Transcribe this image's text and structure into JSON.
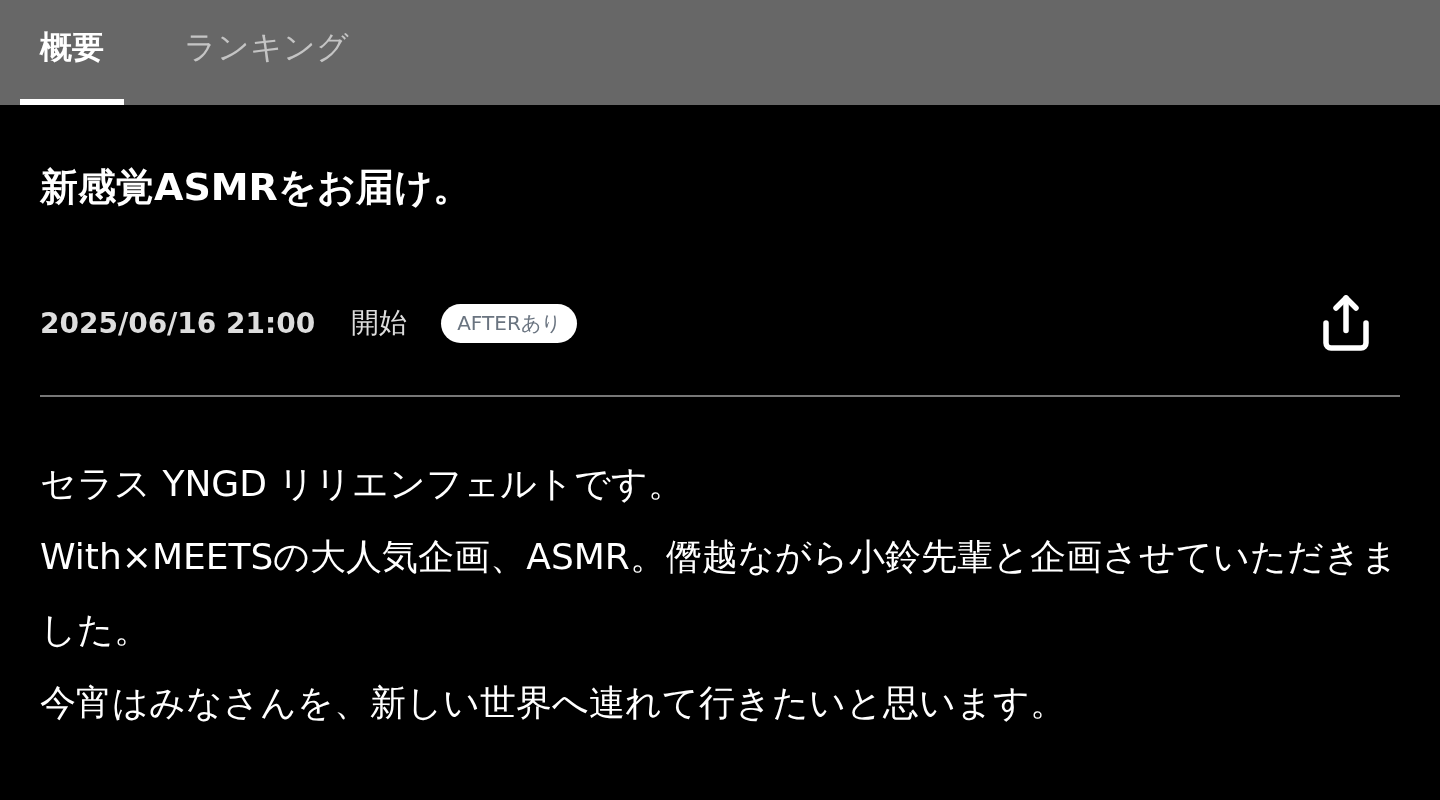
{
  "tabs": [
    {
      "label": "概要",
      "selected": true
    },
    {
      "label": "ランキング",
      "selected": false
    }
  ],
  "title": "新感覚ASMRをお届け。",
  "meta": {
    "datetime": "2025/06/16 21:00",
    "status": "開始",
    "badge": "AFTERあり"
  },
  "description": [
    "セラス YNGD リリエンフェルトです。",
    "With×MEETSの大人気企画、ASMR。僭越ながら小鈴先輩と企画させていただきました。",
    "今宵はみなさんを、新しい世界へ連れて行きたいと思います。"
  ]
}
